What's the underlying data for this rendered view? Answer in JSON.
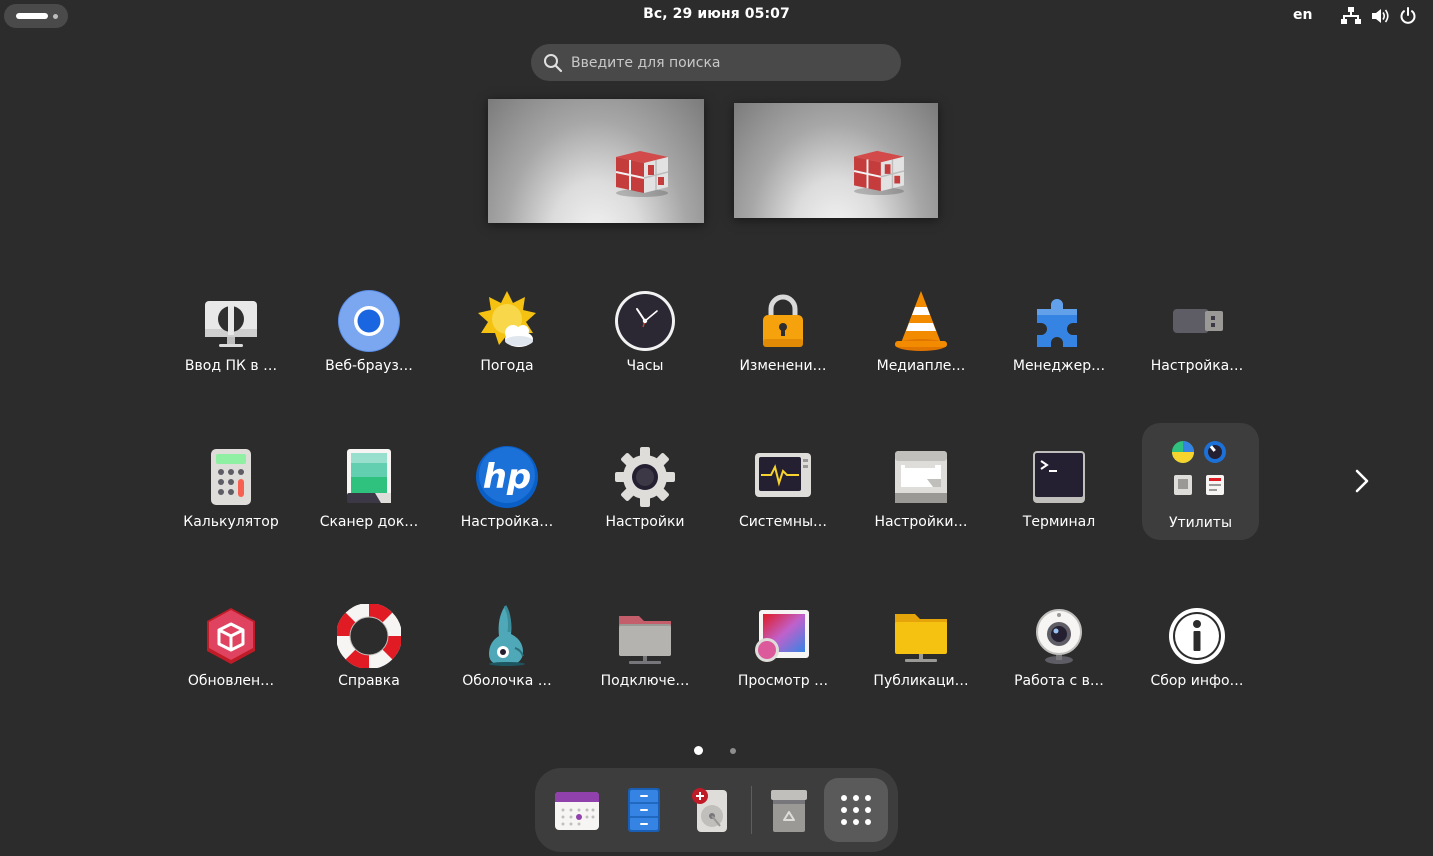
{
  "topbar": {
    "datetime": "Вс, 29 июня  05:07",
    "language": "en",
    "tray": [
      "network-icon",
      "volume-icon",
      "power-icon"
    ]
  },
  "search": {
    "placeholder": "Введите для поиска"
  },
  "app_grid": {
    "rows": [
      [
        {
          "label": "Ввод ПК в …",
          "icon": "remote-input-icon"
        },
        {
          "label": "Веб-брауз…",
          "icon": "chromium-icon"
        },
        {
          "label": "Погода",
          "icon": "weather-icon"
        },
        {
          "label": "Часы",
          "icon": "clock-icon"
        },
        {
          "label": "Изменени…",
          "icon": "lock-icon"
        },
        {
          "label": "Медиапле…",
          "icon": "vlc-icon"
        },
        {
          "label": "Менеджер…",
          "icon": "extensions-icon"
        },
        {
          "label": "Настройка…",
          "icon": "usb-icon"
        }
      ],
      [
        {
          "label": "Калькулятор",
          "icon": "calculator-icon"
        },
        {
          "label": "Сканер док…",
          "icon": "scanner-icon"
        },
        {
          "label": "Настройка…",
          "icon": "hp-icon"
        },
        {
          "label": "Настройки",
          "icon": "settings-icon"
        },
        {
          "label": "Системны…",
          "icon": "system-monitor-icon"
        },
        {
          "label": "Настройки…",
          "icon": "printer-icon"
        },
        {
          "label": "Терминал",
          "icon": "terminal-icon"
        },
        {
          "label": "Утилиты",
          "icon": "utilities-folder-icon"
        }
      ],
      [
        {
          "label": "Обновлен…",
          "icon": "software-update-icon"
        },
        {
          "label": "Справка",
          "icon": "help-icon"
        },
        {
          "label": "Оболочка …",
          "icon": "shell-icon"
        },
        {
          "label": "Подключе…",
          "icon": "network-folder-icon"
        },
        {
          "label": "Просмотр …",
          "icon": "image-viewer-icon"
        },
        {
          "label": "Публикаци…",
          "icon": "public-folder-icon"
        },
        {
          "label": "Работа с в…",
          "icon": "webcam-icon"
        },
        {
          "label": "Сбор инфо…",
          "icon": "info-icon"
        }
      ]
    ]
  },
  "pagination": {
    "current": 1,
    "total": 2
  },
  "dock": [
    "calendar-icon",
    "files-icon",
    "disk-utility-icon",
    "trash-icon",
    "show-apps-icon"
  ],
  "colors": {
    "background": "#2c2c2c",
    "folder": "#3d3d3d",
    "dock": "#3d3d3d",
    "search": "#494949"
  }
}
